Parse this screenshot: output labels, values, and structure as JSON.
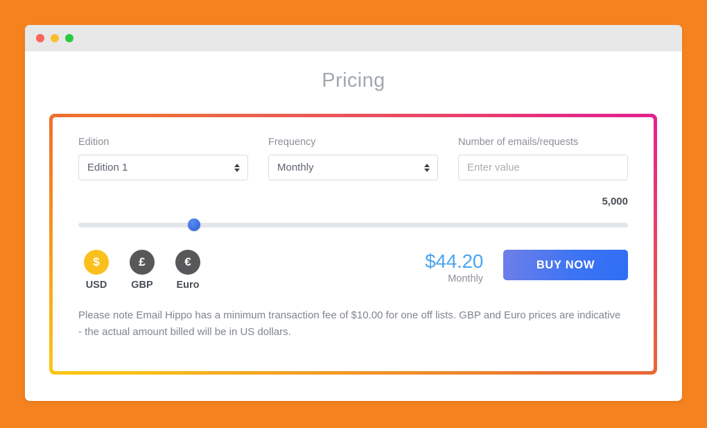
{
  "page": {
    "background_color": "#f5821f",
    "title": "Pricing"
  },
  "window": {
    "controls": [
      {
        "name": "close",
        "color": "#f9655b"
      },
      {
        "name": "minimize",
        "color": "#fbbd2e"
      },
      {
        "name": "maximize",
        "color": "#2ac940"
      }
    ]
  },
  "card": {
    "border_gradient": {
      "top_left": "#ee6e2d",
      "top_right": "#e2238d",
      "bottom_right": "#e96838",
      "bottom_left": "#fac716"
    },
    "fields": [
      {
        "label": "Edition",
        "type": "select",
        "value": "Edition 1",
        "options": [
          "Edition 1"
        ]
      },
      {
        "label": "Frequency",
        "type": "select",
        "value": "Monthly",
        "options": [
          "Monthly"
        ]
      },
      {
        "label": "Number of emails/requests",
        "type": "text",
        "value": "",
        "placeholder": "Enter value"
      }
    ],
    "slider": {
      "value_label": "5,000",
      "percent": 21,
      "track_color": "#e3e6ea",
      "thumb_color": "#3568e0"
    },
    "currencies": [
      {
        "code": "USD",
        "symbol": "$",
        "label": "USD",
        "selected": true,
        "color": "#fcc01c"
      },
      {
        "code": "GBP",
        "symbol": "£",
        "label": "GBP",
        "selected": false,
        "color": "#58585a"
      },
      {
        "code": "EUR",
        "symbol": "€",
        "label": "Euro",
        "selected": false,
        "color": "#58585a"
      }
    ],
    "price": {
      "amount": "$44.20",
      "period": "Monthly",
      "color": "#4da4ef"
    },
    "buy_button": {
      "label": "BUY NOW",
      "color": "#3e74f3"
    },
    "note": "Please note Email Hippo has a minimum transaction fee of $10.00 for one off lists. GBP and Euro prices are indicative - the actual amount billed will be in US dollars."
  }
}
